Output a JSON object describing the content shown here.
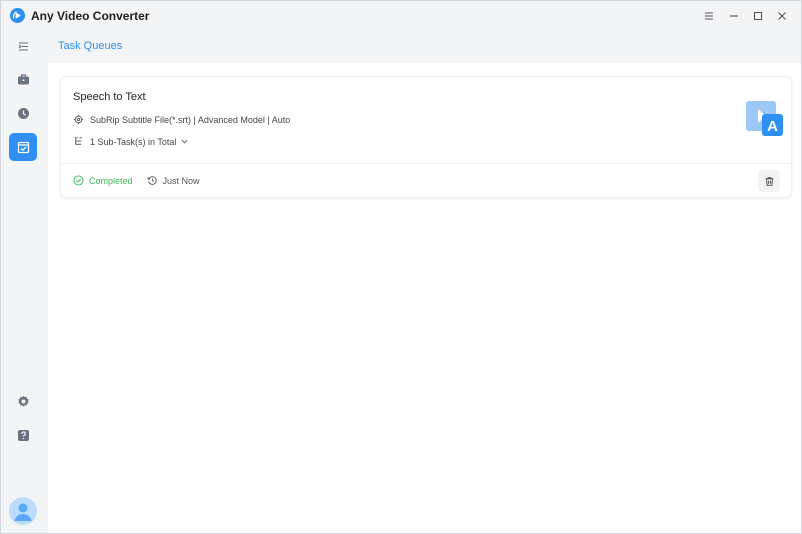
{
  "app": {
    "title": "Any Video Converter",
    "accent_color": "#2f8ff3"
  },
  "window_controls": [
    "menu-icon",
    "minimize-icon",
    "maximize-icon",
    "close-icon"
  ],
  "sidebar": {
    "items": [
      {
        "name": "collapse-menu-icon",
        "active": false
      },
      {
        "name": "toolbox-icon",
        "active": false
      },
      {
        "name": "history-icon",
        "active": false
      },
      {
        "name": "task-queue-icon",
        "active": true
      }
    ],
    "bottom": [
      {
        "name": "settings-icon"
      },
      {
        "name": "help-icon"
      },
      {
        "name": "user-avatar-icon"
      }
    ]
  },
  "main": {
    "page_title": "Task Queues"
  },
  "task": {
    "title": "Speech to Text",
    "format_info": "SubRip Subtitle File(*.srt) | Advanced Model | Auto",
    "subtasks": "1 Sub-Task(s) in Total",
    "status": "Completed",
    "status_color": "#3cba5b",
    "time": "Just Now",
    "thumbnail_icon": "subtitle-file-icon",
    "thumbnail_letter": "A"
  }
}
